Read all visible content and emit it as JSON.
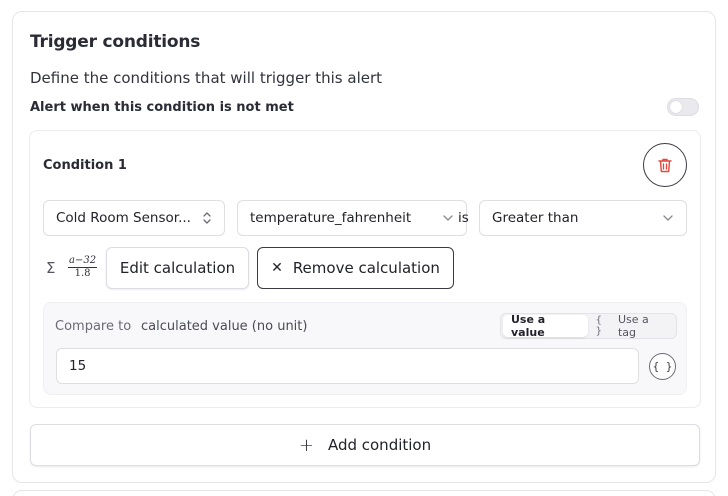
{
  "section": {
    "title": "Trigger conditions",
    "description": "Define the conditions that will trigger this alert",
    "not_met_label": "Alert when this condition is not met",
    "not_met_enabled": false
  },
  "condition": {
    "title": "Condition 1",
    "source_select": "Cold Room Sensor...",
    "field_select": "temperature_fahrenheit",
    "is_label": "is",
    "operator_select": "Greater than",
    "formula": {
      "numerator": "a−32",
      "denominator": "1.8"
    },
    "edit_calc_label": "Edit calculation",
    "remove_calc_label": "Remove calculation",
    "compare": {
      "label": "Compare to",
      "value_label": "calculated value (no unit)",
      "use_value_label": "Use a value",
      "use_tag_label": "Use a tag",
      "tag_icon": "{ }",
      "input_value": "15",
      "brace_button_icon": "{ }"
    }
  },
  "add_condition_label": "Add condition",
  "colors": {
    "delete_icon": "#e4473a",
    "border_dark": "#3a3a44"
  }
}
